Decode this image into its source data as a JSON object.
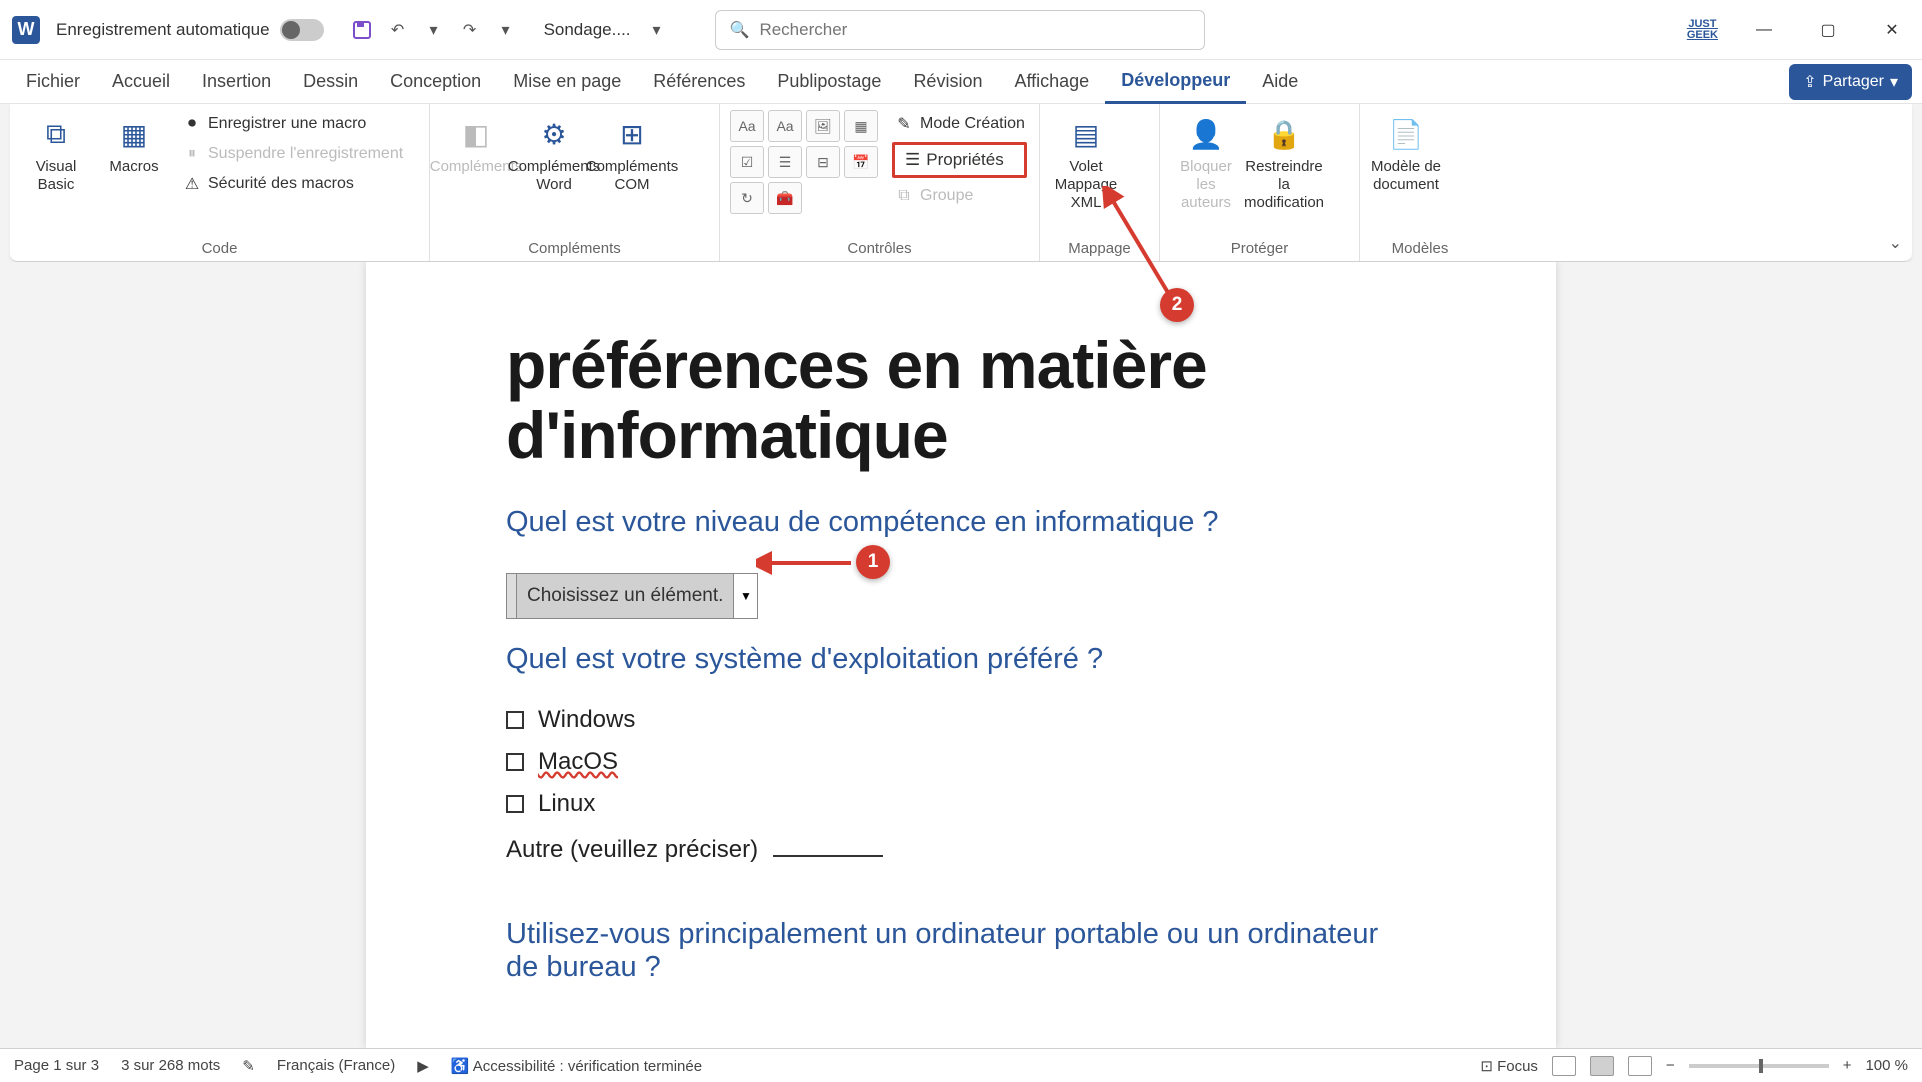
{
  "titlebar": {
    "autosave_label": "Enregistrement automatique",
    "doc_name": "Sondage....",
    "search_placeholder": "Rechercher",
    "logo_line1": "JUST",
    "logo_line2": "GEEK"
  },
  "tabs": {
    "items": [
      "Fichier",
      "Accueil",
      "Insertion",
      "Dessin",
      "Conception",
      "Mise en page",
      "Références",
      "Publipostage",
      "Révision",
      "Affichage",
      "Développeur",
      "Aide"
    ],
    "active_index": 10,
    "share_label": "Partager"
  },
  "ribbon": {
    "code": {
      "visual_basic": "Visual Basic",
      "macros": "Macros",
      "record_macro": "Enregistrer une macro",
      "pause_recording": "Suspendre l'enregistrement",
      "macro_security": "Sécurité des macros",
      "group_label": "Code"
    },
    "addins": {
      "complements": "Compléments",
      "complements_word": "Compléments Word",
      "complements_com": "Compléments COM",
      "group_label": "Compléments"
    },
    "controls": {
      "design_mode": "Mode Création",
      "properties": "Propriétés",
      "group": "Groupe",
      "group_label": "Contrôles"
    },
    "mapping": {
      "xml_pane": "Volet Mappage XML",
      "group_label": "Mappage"
    },
    "protect": {
      "block_authors": "Bloquer les auteurs",
      "restrict_editing": "Restreindre la modification",
      "group_label": "Protéger"
    },
    "templates": {
      "doc_template": "Modèle de document",
      "group_label": "Modèles"
    }
  },
  "document": {
    "title_partial": "préférences en matière d'informatique",
    "q1": "Quel est votre niveau de compétence en informatique ?",
    "dropdown_placeholder": "Choisissez un élément.",
    "q2": "Quel est votre système d'exploitation préféré ?",
    "options": [
      "Windows",
      "MacOS",
      "Linux"
    ],
    "other_label": "Autre (veuillez préciser)",
    "q3": "Utilisez-vous principalement un ordinateur portable ou un ordinateur de bureau ?"
  },
  "annotations": {
    "callout1": "1",
    "callout2": "2"
  },
  "statusbar": {
    "page_info": "Page 1 sur 3",
    "word_count": "3 sur 268 mots",
    "language": "Français (France)",
    "accessibility": "Accessibilité : vérification terminée",
    "focus": "Focus",
    "zoom": "100 %"
  }
}
